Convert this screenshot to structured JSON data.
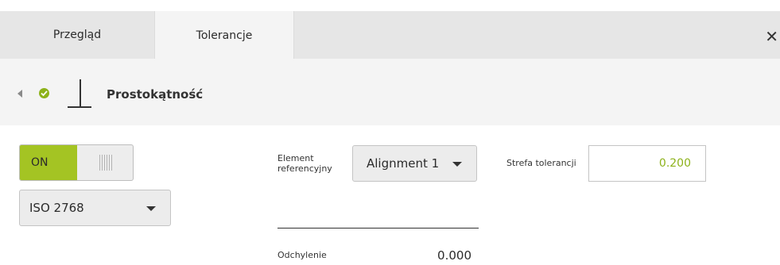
{
  "tabs": [
    {
      "label": "Przegląd",
      "active": false
    },
    {
      "label": "Tolerancje",
      "active": true
    }
  ],
  "close_icon": "close-icon",
  "header": {
    "title": "Prostokątność",
    "status": "ok",
    "symbol": "perpendicularity-icon"
  },
  "toggle": {
    "label": "ON",
    "state": true
  },
  "standard": {
    "value": "ISO 2768"
  },
  "reference": {
    "label": "Element referencyjny",
    "value": "Alignment 1"
  },
  "tolerance_zone": {
    "label": "Strefa tolerancji",
    "value": "0.200"
  },
  "deviation": {
    "label": "Odchylenie",
    "value": "0.000"
  },
  "colors": {
    "accent": "#a4c423",
    "ok": "#8db21a"
  }
}
